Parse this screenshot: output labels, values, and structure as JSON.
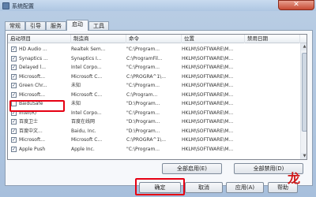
{
  "window": {
    "title": "系统配置",
    "close_symbol": "✕"
  },
  "tabs": [
    {
      "label": "常规"
    },
    {
      "label": "引导"
    },
    {
      "label": "服务"
    },
    {
      "label": "启动",
      "active": true
    },
    {
      "label": "工具"
    }
  ],
  "list": {
    "columns": [
      "启动项目",
      "制造商",
      "命令",
      "位置",
      "禁用日期"
    ],
    "rows": [
      {
        "checked": true,
        "item": "HD Audio ...",
        "maker": "Realtek Sem...",
        "command": "\"C:\\Program...",
        "location": "HKLM\\SOFTWARE\\M..."
      },
      {
        "checked": true,
        "item": "Synaptics ...",
        "maker": "Synaptics I...",
        "command": "C:\\ProgramFil...",
        "location": "HKLM\\SOFTWARE\\M..."
      },
      {
        "checked": true,
        "item": "Delayed l...",
        "maker": "Intel Corpo...",
        "command": "\"C:\\Program...",
        "location": "HKLM\\SOFTWARE\\M..."
      },
      {
        "checked": true,
        "item": "Microsoft...",
        "maker": "Microsoft C...",
        "command": "C:\\PROGRA^1\\...",
        "location": "HKLM\\SOFTWARE\\M..."
      },
      {
        "checked": true,
        "item": "Green Chr...",
        "maker": "未知",
        "command": "\"C:\\Program...",
        "location": "HKLM\\SOFTWARE\\M..."
      },
      {
        "checked": true,
        "item": "Microsoft...",
        "maker": "Microsoft C...",
        "command": "C:\\Program...",
        "location": "HKLM\\SOFTWARE\\M..."
      },
      {
        "checked": false,
        "item": "BaiduSafe",
        "maker": "未知",
        "command": "\"D:\\Program...",
        "location": "HKLM\\SOFTWARE\\M..."
      },
      {
        "checked": true,
        "item": "Intel(R)",
        "maker": "Intel Corpo...",
        "command": "\"C:\\Program...",
        "location": "HKLM\\SOFTWARE\\M..."
      },
      {
        "checked": true,
        "item": "百度卫士",
        "maker": "百度在线网",
        "command": "\"D:\\Program...",
        "location": "HKLM\\SOFTWARE\\M..."
      },
      {
        "checked": true,
        "item": "百度中文...",
        "maker": "Baidu, Inc.",
        "command": "\"D:\\Program...",
        "location": "HKLM\\SOFTWARE\\M..."
      },
      {
        "checked": true,
        "item": "Microsoft...",
        "maker": "Microsoft C...",
        "command": "C:\\PROGRA^1\\...",
        "location": "HKLM\\SOFTWARE\\M..."
      },
      {
        "checked": true,
        "item": "Apple Push",
        "maker": "Apple Inc.",
        "command": "\"C:\\Program...",
        "location": "HKLM\\SOFTWARE\\M..."
      }
    ]
  },
  "buttons": {
    "enable_all": "全部启用(E)",
    "disable_all": "全部禁用(D)",
    "ok": "确定",
    "cancel": "取消",
    "apply": "应用(A)",
    "help": "帮助"
  },
  "scrollbar": {
    "up_symbol": "▲",
    "down_symbol": "▼"
  },
  "watermark": "龙",
  "colors": {
    "highlight": "#e60012"
  }
}
